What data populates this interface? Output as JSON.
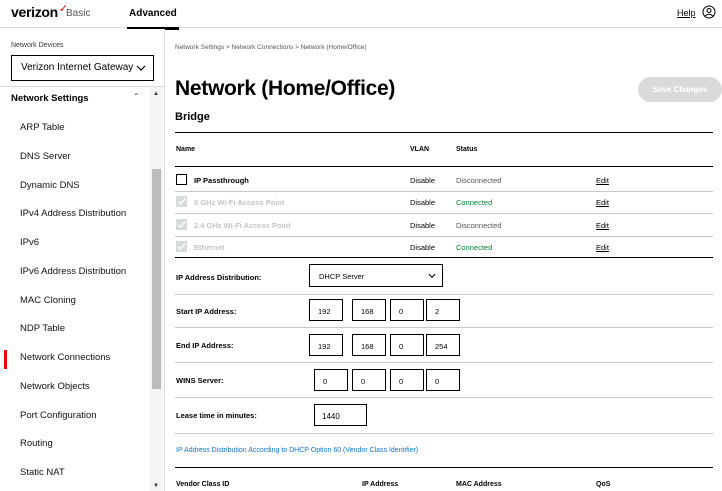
{
  "header": {
    "logo_text": "verizon",
    "logo_mark": "✓",
    "tabs": [
      "Basic",
      "Advanced"
    ],
    "help_label": "Help",
    "accent_color": "#ee0000"
  },
  "sidebar": {
    "devices_label": "Network Devices",
    "device_selected": "Verizon Internet Gateway",
    "section_label": "Network Settings",
    "items": [
      {
        "label": "ARP Table",
        "active": false
      },
      {
        "label": "DNS Server",
        "active": false
      },
      {
        "label": "Dynamic DNS",
        "active": false
      },
      {
        "label": "IPv4 Address Distribution",
        "active": false
      },
      {
        "label": "IPv6",
        "active": false
      },
      {
        "label": "IPv6 Address Distribution",
        "active": false
      },
      {
        "label": "MAC Cloning",
        "active": false
      },
      {
        "label": "NDP Table",
        "active": false
      },
      {
        "label": "Network Connections",
        "active": true
      },
      {
        "label": "Network Objects",
        "active": false
      },
      {
        "label": "Port Configuration",
        "active": false
      },
      {
        "label": "Routing",
        "active": false
      },
      {
        "label": "Static NAT",
        "active": false
      }
    ]
  },
  "main": {
    "breadcrumb": "Network Settings  >  Network Connections  >  Network (Home/Office)",
    "title": "Network (Home/Office)",
    "save_label": "Save Changes",
    "bridge": {
      "title": "Bridge",
      "headers": [
        "Name",
        "VLAN",
        "Status"
      ],
      "rows": [
        {
          "name": "IP Passthrough",
          "vlan": "Disable",
          "status": "Disconnected",
          "action": "Edit",
          "enabled": true,
          "status_color": "#555555"
        },
        {
          "name": "5 GHz Wi-Fi Access Point",
          "vlan": "Disable",
          "status": "Connected",
          "action": "Edit",
          "enabled": false,
          "status_color": "#008331"
        },
        {
          "name": "2.4 GHz Wi-Fi Access Point",
          "vlan": "Disable",
          "status": "Disconnected",
          "action": "Edit",
          "enabled": false,
          "status_color": "#555555"
        },
        {
          "name": "Ethernet",
          "vlan": "Disable",
          "status": "Connected",
          "action": "Edit",
          "enabled": false,
          "status_color": "#008331"
        }
      ]
    },
    "form": {
      "ip_distribution_label": "IP Address Distribution:",
      "ip_distribution_value": "DHCP Server",
      "start_ip_label": "Start IP Address:",
      "start_ip": [
        "192",
        "168",
        "0",
        "2"
      ],
      "end_ip_label": "End IP Address:",
      "end_ip": [
        "192",
        "168",
        "0",
        "254"
      ],
      "wins_label": "WINS Server:",
      "wins": [
        "0",
        "0",
        "0",
        "0"
      ],
      "lease_label": "Lease time in minutes:",
      "lease_value": "1440",
      "dhcp_option_link": "IP Address Distribution According to DHCP Option 60 (Vendor Class Identifier)"
    },
    "vendor_table": {
      "headers": [
        "Vendor Class ID",
        "IP Address",
        "MAC Address",
        "QoS"
      ]
    }
  }
}
